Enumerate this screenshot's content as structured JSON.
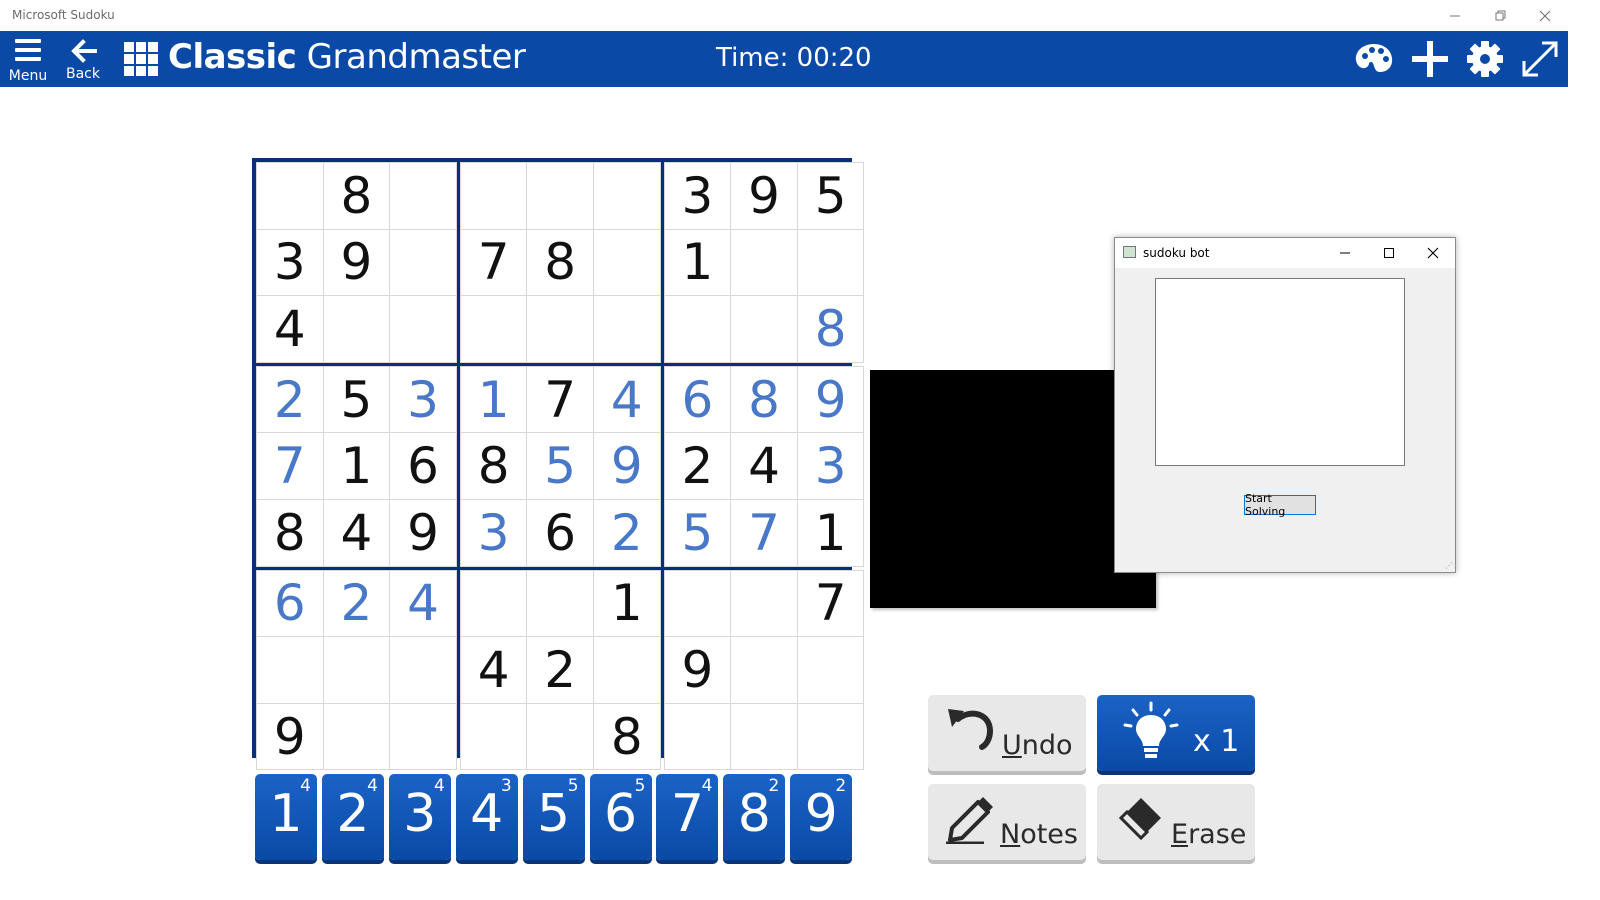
{
  "window": {
    "title": "Microsoft Sudoku",
    "controls": [
      "minimize",
      "restore",
      "close"
    ]
  },
  "appbar": {
    "menu_label": "Menu",
    "back_label": "Back",
    "title_bold": "Classic",
    "title_rest": "Grandmaster",
    "timer": "Time: 00:20",
    "icons": [
      "palette-icon",
      "plus-icon",
      "gear-icon",
      "fullscreen-icon"
    ]
  },
  "board": {
    "grid": [
      [
        "",
        "8",
        "",
        "",
        "",
        "",
        "3",
        "9",
        "5"
      ],
      [
        "3",
        "9",
        "",
        "7",
        "8",
        "",
        "1",
        "",
        ""
      ],
      [
        "4",
        "",
        "",
        "",
        "",
        "",
        "",
        "",
        "8"
      ],
      [
        "2",
        "5",
        "3",
        "1",
        "7",
        "4",
        "6",
        "8",
        "9"
      ],
      [
        "7",
        "1",
        "6",
        "8",
        "5",
        "9",
        "2",
        "4",
        "3"
      ],
      [
        "8",
        "4",
        "9",
        "3",
        "6",
        "2",
        "5",
        "7",
        "1"
      ],
      [
        "6",
        "2",
        "4",
        "",
        "",
        "1",
        "",
        "",
        "7"
      ],
      [
        "",
        "",
        "",
        "4",
        "2",
        "",
        "9",
        "",
        ""
      ],
      [
        "9",
        "",
        "",
        "",
        "",
        "8",
        "",
        "",
        ""
      ]
    ],
    "styles": [
      [
        "",
        "g",
        "",
        "",
        "",
        "",
        "g",
        "g",
        "g"
      ],
      [
        "g",
        "g",
        "",
        "g",
        "g",
        "",
        "g",
        "",
        ""
      ],
      [
        "g",
        "",
        "",
        "",
        "",
        "",
        "",
        "",
        "u"
      ],
      [
        "u",
        "g",
        "u",
        "u",
        "g",
        "u",
        "u",
        "u",
        "u"
      ],
      [
        "u",
        "g",
        "g",
        "g",
        "u",
        "u",
        "g",
        "g",
        "u"
      ],
      [
        "g",
        "g",
        "g",
        "u",
        "g",
        "u",
        "u",
        "u",
        "g"
      ],
      [
        "u",
        "u",
        "u",
        "",
        "",
        "g",
        "",
        "",
        "g"
      ],
      [
        "",
        "",
        "",
        "g",
        "g",
        "",
        "g",
        "",
        ""
      ],
      [
        "g",
        "",
        "",
        "",
        "",
        "g",
        "",
        "",
        ""
      ]
    ],
    "given_color": "#111111",
    "user_color": "#4a78c8"
  },
  "numpad": [
    {
      "digit": "1",
      "remaining": "4"
    },
    {
      "digit": "2",
      "remaining": "4"
    },
    {
      "digit": "3",
      "remaining": "4"
    },
    {
      "digit": "4",
      "remaining": "3"
    },
    {
      "digit": "5",
      "remaining": "5"
    },
    {
      "digit": "6",
      "remaining": "5"
    },
    {
      "digit": "7",
      "remaining": "4"
    },
    {
      "digit": "8",
      "remaining": "2"
    },
    {
      "digit": "9",
      "remaining": "2"
    }
  ],
  "actions": {
    "undo": {
      "prefix": "U",
      "rest": "ndo"
    },
    "hint": {
      "count": "x 1"
    },
    "notes": {
      "prefix": "N",
      "rest": "otes"
    },
    "erase": {
      "prefix": "E",
      "rest": "rase"
    }
  },
  "bot": {
    "title": "sudoku bot",
    "button": "Start Solving"
  },
  "colors": {
    "appbar": "#0a4aa6",
    "board_border": "#0a2f7a"
  }
}
